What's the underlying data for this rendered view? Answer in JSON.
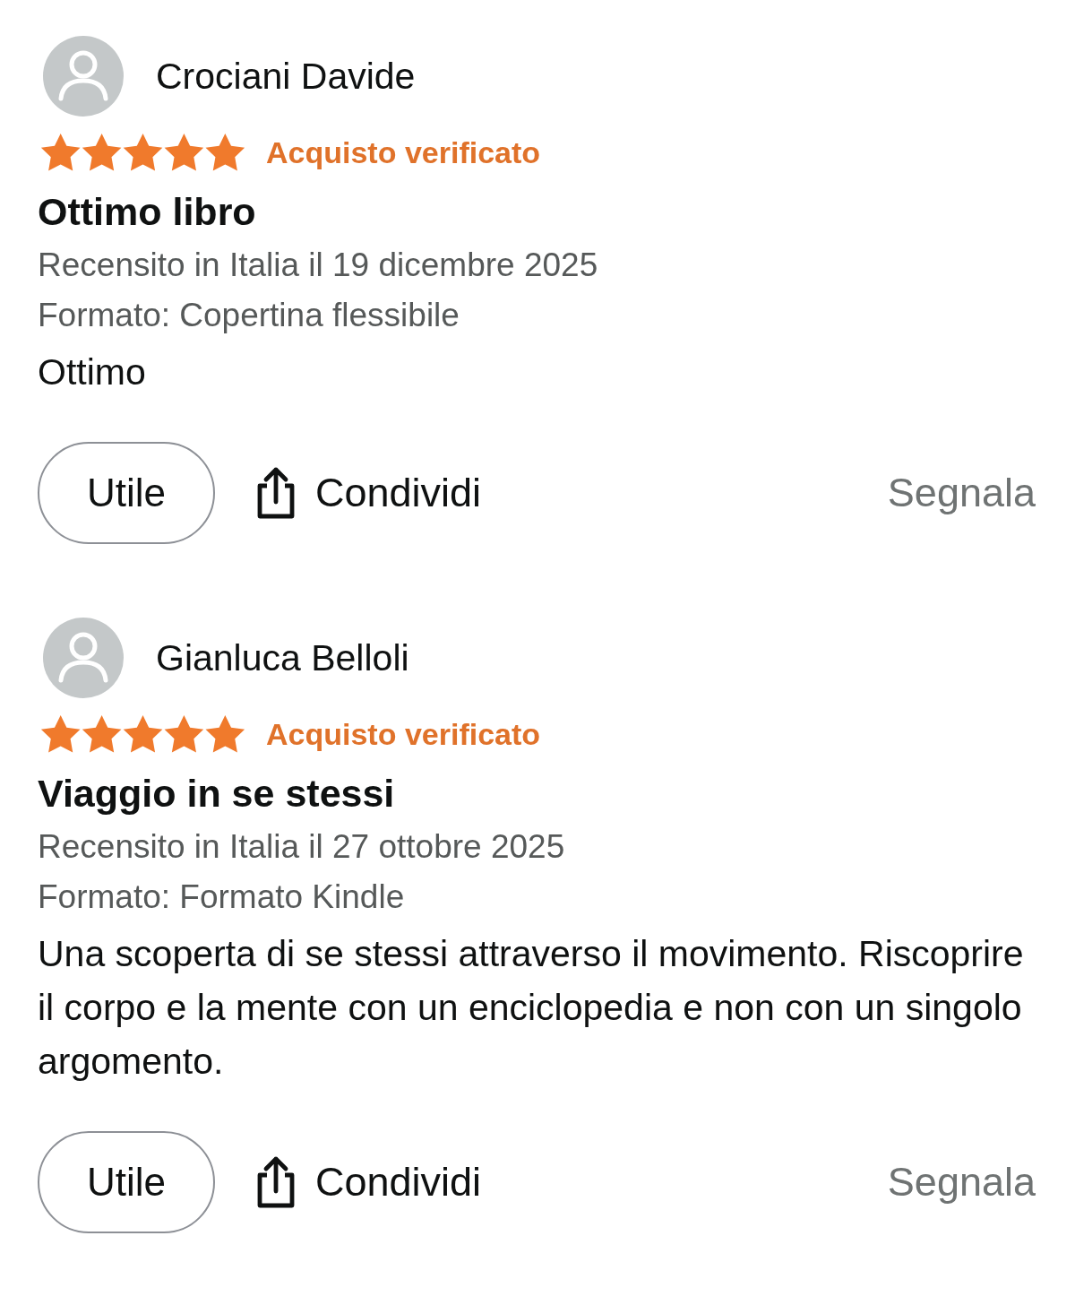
{
  "reviews": [
    {
      "author": "Crociani Davide",
      "stars": 5,
      "badge": "Acquisto verificato",
      "title": "Ottimo libro",
      "date": "Recensito in Italia il 19 dicembre 2025",
      "format": "Formato: Copertina flessibile",
      "body": "Ottimo",
      "actions": {
        "helpful": "Utile",
        "share": "Condividi",
        "report": "Segnala"
      }
    },
    {
      "author": "Gianluca Belloli",
      "stars": 5,
      "badge": "Acquisto verificato",
      "title": "Viaggio in se stessi",
      "date": "Recensito in Italia il 27 ottobre 2025",
      "format": "Formato: Formato Kindle",
      "body": "Una scoperta di se stessi attraverso il movimento. Riscoprire il corpo e la mente con un enciclopedia e non con un singolo argomento.",
      "actions": {
        "helpful": "Utile",
        "share": "Condividi",
        "report": "Segnala"
      }
    }
  ]
}
